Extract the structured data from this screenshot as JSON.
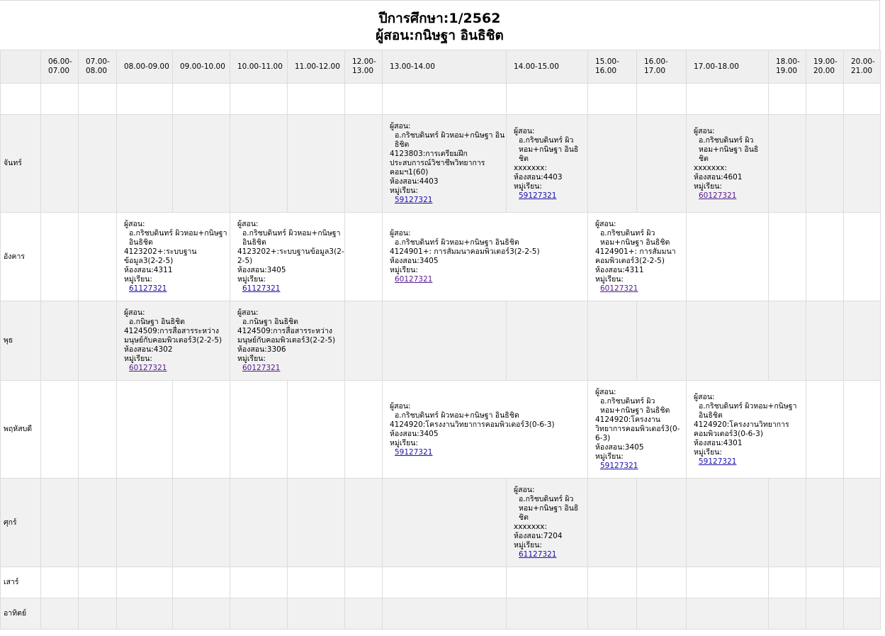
{
  "title": {
    "year": "ปีการศึกษา:1/2562",
    "teacher": "ผู้สอน:กนิษฐา อินธิชิต"
  },
  "time_slots": [
    "06.00-07.00",
    "07.00-08.00",
    "08.00-09.00",
    "09.00-10.00",
    "10.00-11.00",
    "11.00-12.00",
    "12.00-13.00",
    "13.00-14.00",
    "14.00-15.00",
    "15.00-16.00",
    "16.00-17.00",
    "17.00-18.00",
    "18.00-19.00",
    "19.00-20.00",
    "20.00-21.00"
  ],
  "days": {
    "mon": "จันทร์",
    "tue": "อังคาร",
    "wed": "พุธ",
    "thu": "พฤหัสบดี",
    "fri": "ศุกร์",
    "sat": "เสาร์",
    "sun": "อาทิตย์"
  },
  "labels": {
    "teacher": "ผู้สอน:",
    "room": "ห้องสอน:",
    "group": "หมู่เรียน:"
  },
  "classes": {
    "mon_1300": {
      "teachers": "อ.กริชบดินทร์ ผิวหอม+กนิษฐา อินธิชิต",
      "course": "4123803:การเตรียมฝึกประสบการณ์วิชาชีพวิทยาการคอมฯ1(60)",
      "room": "4403",
      "group": "59127321"
    },
    "mon_1400": {
      "teachers": "อ.กริชบดินทร์ ผิวหอม+กนิษฐา อินธิชิต",
      "course": "xxxxxxx:",
      "room": "4403",
      "group": "59127321"
    },
    "mon_1700": {
      "teachers": "อ.กริชบดินทร์ ผิวหอม+กนิษฐา อินธิชิต",
      "course": "xxxxxxx:",
      "room": "4601",
      "group": "60127321"
    },
    "tue_0800": {
      "teachers": "อ.กริชบดินทร์ ผิวหอม+กนิษฐา อินธิชิต",
      "course": "4123202+:ระบบฐานข้อมูล3(2-2-5)",
      "room": "4311",
      "group": "61127321"
    },
    "tue_1000": {
      "teachers": "อ.กริชบดินทร์ ผิวหอม+กนิษฐา อินธิชิต",
      "course": "4123202+:ระบบฐานข้อมูล3(2-2-5)",
      "room": "3405",
      "group": "61127321"
    },
    "tue_1300": {
      "teachers": "อ.กริชบดินทร์ ผิวหอม+กนิษฐา อินธิชิต",
      "course": "4124901+: การสัมมนาคอมพิวเตอร์3(2-2-5)",
      "room": "3405",
      "group": "60127321"
    },
    "tue_1500": {
      "teachers": "อ.กริชบดินทร์ ผิวหอม+กนิษฐา อินธิชิต",
      "course": "4124901+: การสัมมนาคอมพิวเตอร์3(2-2-5)",
      "room": "4311",
      "group": "60127321"
    },
    "wed_0800": {
      "teachers": "อ.กนิษฐา อินธิชิต",
      "course": "4124509:การสื่อสารระหว่างมนุษย์กับคอมพิวเตอร์3(2-2-5)",
      "room": "4302",
      "group": "60127321"
    },
    "wed_1000": {
      "teachers": "อ.กนิษฐา อินธิชิต",
      "course": "4124509:การสื่อสารระหว่างมนุษย์กับคอมพิวเตอร์3(2-2-5)",
      "room": "3306",
      "group": "60127321"
    },
    "thu_1300": {
      "teachers": "อ.กริชบดินทร์ ผิวหอม+กนิษฐา อินธิชิต",
      "course": "4124920:โครงงานวิทยาการคอมพิวเตอร์3(0-6-3)",
      "room": "3405",
      "group": "59127321"
    },
    "thu_1500": {
      "teachers": "อ.กริชบดินทร์ ผิวหอม+กนิษฐา อินธิชิต",
      "course": "4124920:โครงงานวิทยาการคอมพิวเตอร์3(0-6-3)",
      "room": "3405",
      "group": "59127321"
    },
    "thu_1700": {
      "teachers": "อ.กริชบดินทร์ ผิวหอม+กนิษฐา อินธิชิต",
      "course": "4124920:โครงงานวิทยาการคอมพิวเตอร์3(0-6-3)",
      "room": "4301",
      "group": "59127321"
    },
    "fri_1400": {
      "teachers": "อ.กริชบดินทร์ ผิวหอม+กนิษฐา อินธิชิต",
      "course": "xxxxxxx:",
      "room": "7204",
      "group": "61127321"
    }
  }
}
